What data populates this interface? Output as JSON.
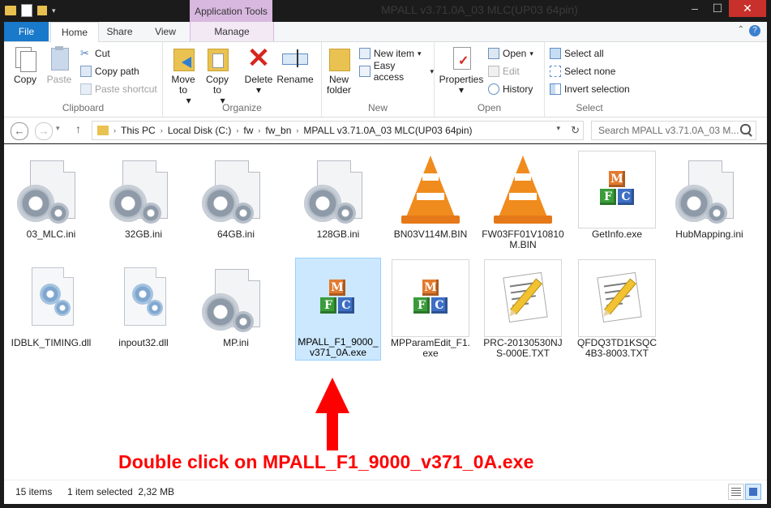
{
  "window": {
    "title": "MPALL v3.71.0A_03 MLC(UP03 64pin)",
    "context_tab": "Application Tools"
  },
  "tabs": {
    "file": "File",
    "home": "Home",
    "share": "Share",
    "view": "View",
    "manage": "Manage"
  },
  "ribbon": {
    "clipboard": {
      "label": "Clipboard",
      "copy": "Copy",
      "paste": "Paste",
      "cut": "Cut",
      "copy_path": "Copy path",
      "paste_shortcut": "Paste shortcut"
    },
    "organize": {
      "label": "Organize",
      "move_to": "Move to",
      "copy_to": "Copy to",
      "delete": "Delete",
      "rename": "Rename",
      "to": "to"
    },
    "new": {
      "label": "New",
      "new_folder_1": "New",
      "new_folder_2": "folder",
      "new_item": "New item",
      "easy_access": "Easy access"
    },
    "open": {
      "label": "Open",
      "properties": "Properties",
      "open": "Open",
      "edit": "Edit",
      "history": "History"
    },
    "select": {
      "label": "Select",
      "select_all": "Select all",
      "select_none": "Select none",
      "invert_selection": "Invert selection"
    }
  },
  "address": {
    "crumbs": [
      "This PC",
      "Local Disk (C:)",
      "fw",
      "fw_bn",
      "MPALL v3.71.0A_03 MLC(UP03 64pin)"
    ],
    "search_placeholder": "Search MPALL v3.71.0A_03 M..."
  },
  "files": [
    {
      "name": "03_MLC.ini",
      "icon": "settings-gear-icon"
    },
    {
      "name": "32GB.ini",
      "icon": "settings-gear-icon"
    },
    {
      "name": "64GB.ini",
      "icon": "settings-gear-icon"
    },
    {
      "name": "128GB.ini",
      "icon": "settings-gear-icon"
    },
    {
      "name": "BN03V114M.BIN",
      "icon": "vlc-cone-icon"
    },
    {
      "name": "FW03FF01V10810M.BIN",
      "icon": "vlc-cone-icon"
    },
    {
      "name": "GetInfo.exe",
      "icon": "mfc-app-icon"
    },
    {
      "name": "HubMapping.ini",
      "icon": "settings-gear-icon"
    },
    {
      "name": "IDBLK_TIMING.dll",
      "icon": "dll-gear-icon"
    },
    {
      "name": "inpout32.dll",
      "icon": "dll-gear-icon"
    },
    {
      "name": "MP.ini",
      "icon": "settings-gear-icon"
    },
    {
      "name": "MPALL_F1_9000_v371_0A.exe",
      "icon": "mfc-app-icon",
      "selected": true
    },
    {
      "name": "MPParamEdit_F1.exe",
      "icon": "mfc-app-icon"
    },
    {
      "name": "PRC-20130530NJS-000E.TXT",
      "icon": "notepad-text-icon"
    },
    {
      "name": "QFDQ3TD1KSQC4B3-8003.TXT",
      "icon": "notepad-text-icon"
    }
  ],
  "annotation": {
    "text": "Double click on MPALL_F1_9000_v371_0A.exe",
    "color": "#ff0000"
  },
  "status": {
    "items": "15 items",
    "selection": "1 item selected  2,32 MB"
  },
  "colors": {
    "accent": "#1979ca",
    "context_tab": "#d9b8e0",
    "selection": "#cce8ff",
    "close": "#c7302b"
  }
}
